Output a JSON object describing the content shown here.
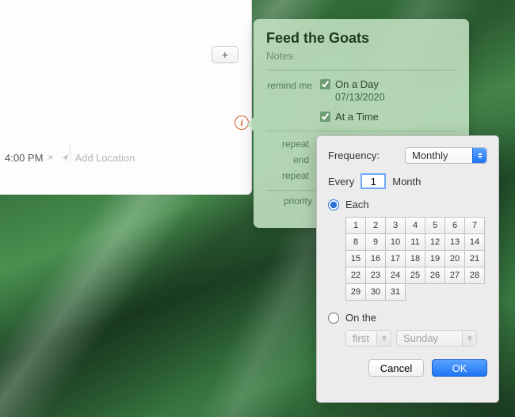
{
  "window": {
    "add_btn_glyph": "+",
    "row": {
      "time": "4:00 PM",
      "clear_glyph": "×",
      "add_location": "Add Location"
    }
  },
  "popover": {
    "title": "Feed the Goats",
    "notes_placeholder": "Notes",
    "remind_me_label": "remind me",
    "on_a_day": "On a Day",
    "date": "07/13/2020",
    "at_a_time": "At a Time",
    "repeat_label": "repeat",
    "end_repeat_label": "end repeat",
    "priority_label": "priority"
  },
  "panel": {
    "frequency_label": "Frequency:",
    "frequency_value": "Monthly",
    "every_label": "Every",
    "every_value": "1",
    "every_unit": "Month",
    "each_label": "Each",
    "days": [
      "1",
      "2",
      "3",
      "4",
      "5",
      "6",
      "7",
      "8",
      "9",
      "10",
      "11",
      "12",
      "13",
      "14",
      "15",
      "16",
      "17",
      "18",
      "19",
      "20",
      "21",
      "22",
      "23",
      "24",
      "25",
      "26",
      "27",
      "28",
      "29",
      "30",
      "31"
    ],
    "on_the_label": "On the",
    "on_the_ordinal": "first",
    "on_the_day": "Sunday",
    "cancel": "Cancel",
    "ok": "OK"
  },
  "info_glyph": "i"
}
